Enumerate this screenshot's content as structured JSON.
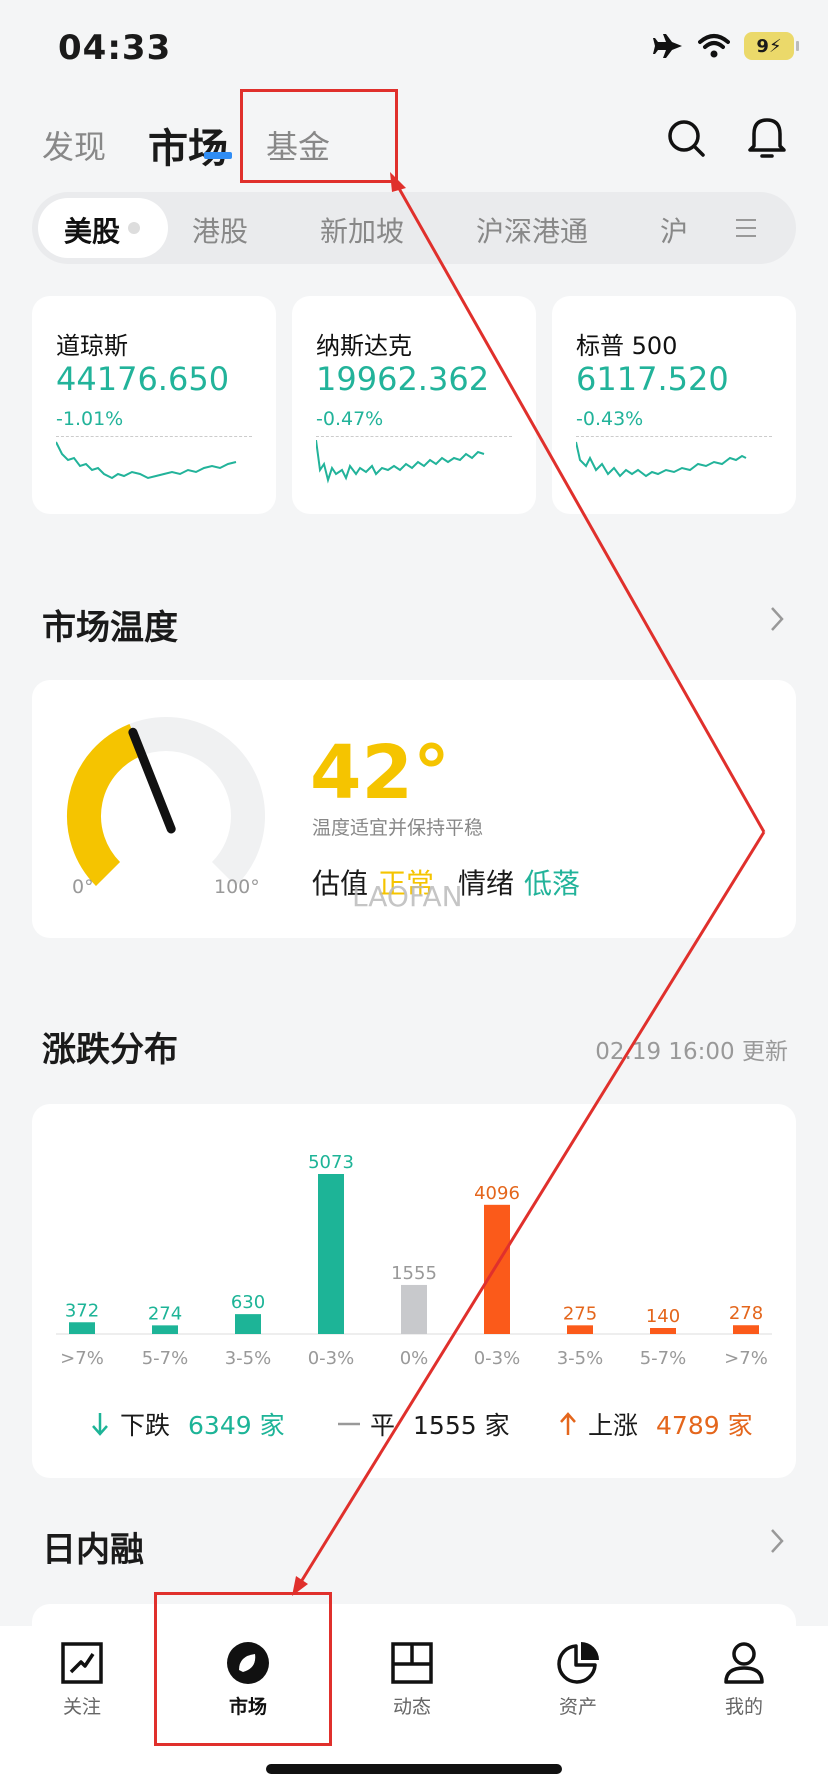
{
  "status_bar": {
    "time": "04:33",
    "battery": "9"
  },
  "top_nav": {
    "discover": "发现",
    "market": "市场",
    "fund": "基金"
  },
  "region_tabs": [
    "美股",
    "港股",
    "新加坡",
    "沪深港通",
    "沪"
  ],
  "indices": [
    {
      "name": "道琼斯",
      "value": "44176.650",
      "change": "-1.01%"
    },
    {
      "name": "纳斯达克",
      "value": "19962.362",
      "change": "-0.47%"
    },
    {
      "name": "标普 500",
      "value": "6117.520",
      "change": "-0.43%"
    }
  ],
  "temperature": {
    "title": "市场温度",
    "value": "42°",
    "value_num": 42,
    "desc": "温度适宜并保持平稳",
    "min_label": "0°",
    "max_label": "100°",
    "valuation_label": "估值",
    "valuation_value": "正常",
    "sentiment_label": "情绪",
    "sentiment_value": "低落",
    "watermark": "LAOFAN",
    "colors": {
      "warm": "#f5c400",
      "track": "#f0f1f2",
      "green": "#22b39a"
    }
  },
  "distribution": {
    "title": "涨跌分布",
    "updated": "02.19 16:00 更新",
    "down_label": "下跌",
    "down_count": "6349 家",
    "flat_label": "平",
    "flat_count": "1555 家",
    "up_label": "上涨",
    "up_count": "4789 家"
  },
  "chart_data": {
    "type": "bar",
    "categories": [
      ">7%",
      "5-7%",
      "3-5%",
      "0-3%",
      "0%",
      "0-3%",
      "3-5%",
      "5-7%",
      ">7%"
    ],
    "values": [
      372,
      274,
      630,
      5073,
      1555,
      4096,
      275,
      140,
      278
    ],
    "colors": [
      "#1db497",
      "#1db497",
      "#1db497",
      "#1db497",
      "#c8c9cc",
      "#fb5a1a",
      "#fb5a1a",
      "#fb5a1a",
      "#fb5a1a"
    ],
    "label_colors": [
      "#1db497",
      "#1db497",
      "#1db497",
      "#1db497",
      "#999999",
      "#e4661c",
      "#e4661c",
      "#e4661c",
      "#e4661c"
    ]
  },
  "intraday": {
    "title": "日内融"
  },
  "bottom_nav": [
    "关注",
    "市场",
    "动态",
    "资产",
    "我的"
  ]
}
